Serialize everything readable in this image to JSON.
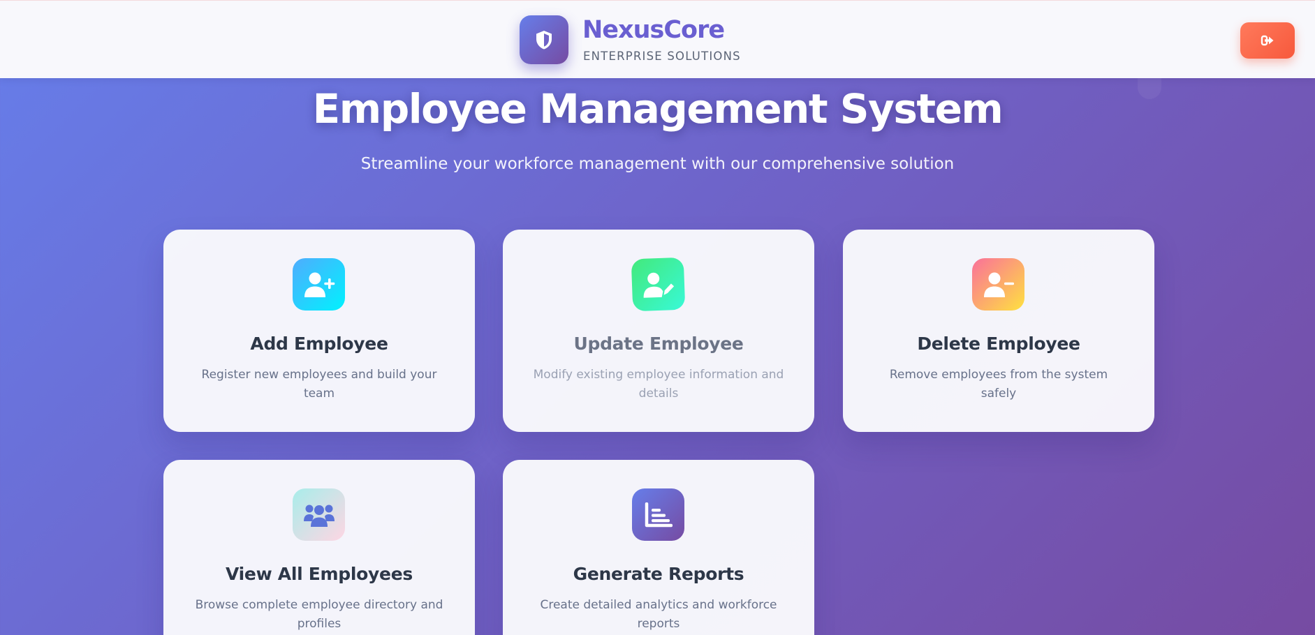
{
  "header": {
    "brand_name": "NexusCore",
    "brand_tagline": "ENTERPRISE SOLUTIONS",
    "logo_icon": "shield-icon",
    "logout_icon": "sign-out-icon"
  },
  "hero": {
    "title": "Employee Management System",
    "subtitle": "Streamline your workforce management with our comprehensive solution"
  },
  "cards": [
    {
      "title": "Add Employee",
      "description": "Register new employees and build your team",
      "icon": "user-plus-icon",
      "gradient": [
        "#4facfe",
        "#00f2fe"
      ]
    },
    {
      "title": "Update Employee",
      "description": "Modify existing employee information and details",
      "icon": "user-edit-icon",
      "gradient": [
        "#43e97b",
        "#38f9d7"
      ]
    },
    {
      "title": "Delete Employee",
      "description": "Remove employees from the system safely",
      "icon": "user-minus-icon",
      "gradient": [
        "#fa709a",
        "#fee140"
      ]
    },
    {
      "title": "View All Employees",
      "description": "Browse complete employee directory and profiles",
      "icon": "users-icon",
      "gradient": [
        "#a8edea",
        "#fed6e3"
      ]
    },
    {
      "title": "Generate Reports",
      "description": "Create detailed analytics and workforce reports",
      "icon": "chart-bar-icon",
      "gradient": [
        "#667eea",
        "#764ba2"
      ]
    }
  ],
  "colors": {
    "background_start": "#667eea",
    "background_end": "#764ba2",
    "brand_text": "#6a5fd1",
    "logout_button": "#f7593c",
    "card_title": "#2d3748",
    "card_description": "#67718a"
  }
}
